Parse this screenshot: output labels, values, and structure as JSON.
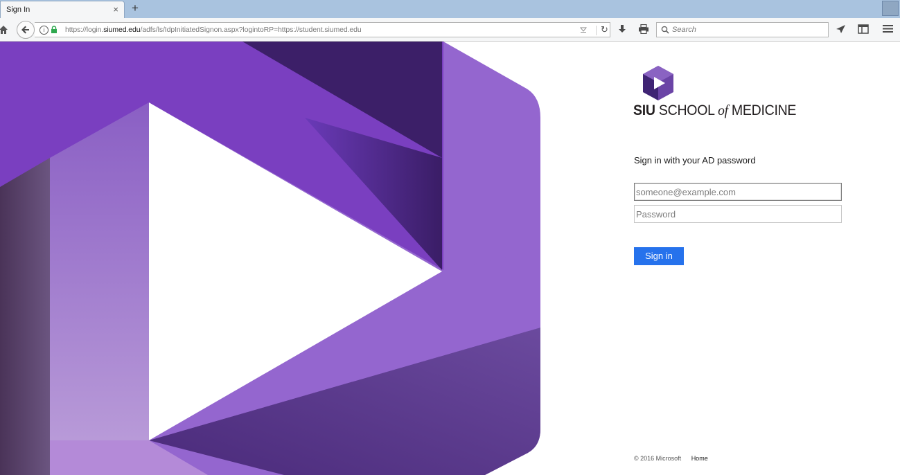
{
  "browser": {
    "tab_title": "Sign In",
    "tab_close": "×",
    "new_tab": "+",
    "url_prefix": "https://login.",
    "url_domain": "siumed.edu",
    "url_path": "/adfs/ls/IdpInitiatedSignon.aspx?logintoRP=https://student.siumed.edu",
    "search_placeholder": "Search",
    "reload": "↻"
  },
  "brand": {
    "logo_word_siu": "SIU",
    "logo_word_school": "SCHOOL",
    "logo_word_of": "of",
    "logo_word_medicine": "MEDICINE"
  },
  "form": {
    "heading": "Sign in with your AD password",
    "username_placeholder": "someone@example.com",
    "password_placeholder": "Password",
    "signin_label": "Sign in"
  },
  "footer": {
    "copyright": "© 2016 Microsoft",
    "home_link": "Home"
  },
  "colors": {
    "accent_button": "#2672ec",
    "brand_purple": "#7a3fc0",
    "tab_strip": "#a9c3df"
  }
}
